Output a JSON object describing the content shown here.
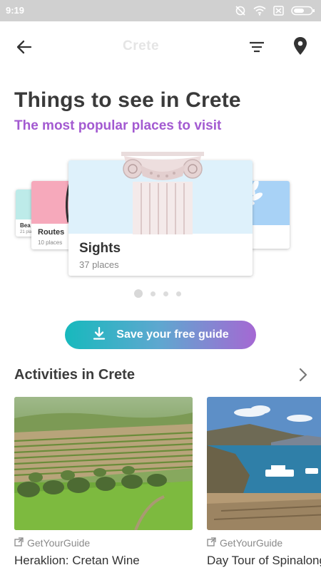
{
  "status_bar": {
    "time": "9:19",
    "icons": [
      "alarm-off-icon",
      "wifi-icon",
      "sim-icon",
      "battery-icon"
    ]
  },
  "app_bar": {
    "title": "Crete",
    "icons": [
      "back-arrow-icon",
      "filter-icon",
      "location-pin-icon"
    ]
  },
  "header": {
    "title": "Things to see in Crete",
    "subtitle": "The most popular places to visit"
  },
  "carousel": {
    "cards": [
      {
        "name": "Bea",
        "count": "21 pla"
      },
      {
        "name": "Routes",
        "count": "10 places"
      },
      {
        "name": "Sights",
        "count": "37 places"
      },
      {
        "name": "",
        "count": ""
      }
    ],
    "active_index": 0,
    "dot_count": 4
  },
  "save_button": {
    "label": "Save your free guide",
    "icon": "download-icon"
  },
  "activities": {
    "title": "Activities in Crete",
    "items": [
      {
        "provider": "GetYourGuide",
        "title": "Heraklion: Cretan Wine"
      },
      {
        "provider": "GetYourGuide",
        "title": "Day Tour of Spinalonga"
      }
    ]
  },
  "colors": {
    "accent_purple": "#a35ad1",
    "gradient_start": "#17b9bd",
    "gradient_end": "#a568d3",
    "status_bar": "#d0d0d0"
  }
}
